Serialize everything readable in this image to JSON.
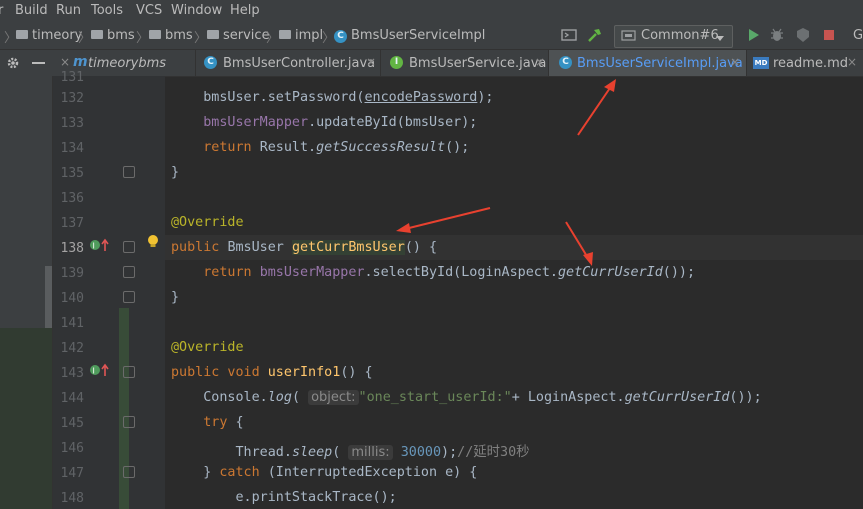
{
  "menu": [
    "r",
    "Build",
    "Run",
    "Tools",
    "VCS",
    "Window",
    "Help"
  ],
  "breadcrumbs": [
    "timeory",
    "bms",
    "bms",
    "service",
    "impl",
    "BmsUserServiceImpl"
  ],
  "run_config": {
    "label": "Common#6"
  },
  "right_edge_text": "G",
  "tabs": [
    {
      "label": "timeorybms",
      "icon": "module-icon"
    },
    {
      "label": "BmsUserController.java",
      "icon": "class-icon"
    },
    {
      "label": "BmsUserService.java",
      "icon": "interface-icon"
    },
    {
      "label": "BmsUserServiceImpl.java",
      "icon": "class-icon",
      "active": true
    },
    {
      "label": "readme.md",
      "icon": "markdown-icon"
    }
  ],
  "editor": {
    "line_numbers": [
      "131",
      "132",
      "133",
      "134",
      "135",
      "136",
      "137",
      "138",
      "139",
      "140",
      "141",
      "142",
      "143",
      "144",
      "145",
      "146",
      "147",
      "148"
    ],
    "hints": {
      "object": "object:",
      "millis": "millis:"
    }
  },
  "colors": {
    "accent": "#589df6",
    "arrow": "#e8412f"
  }
}
